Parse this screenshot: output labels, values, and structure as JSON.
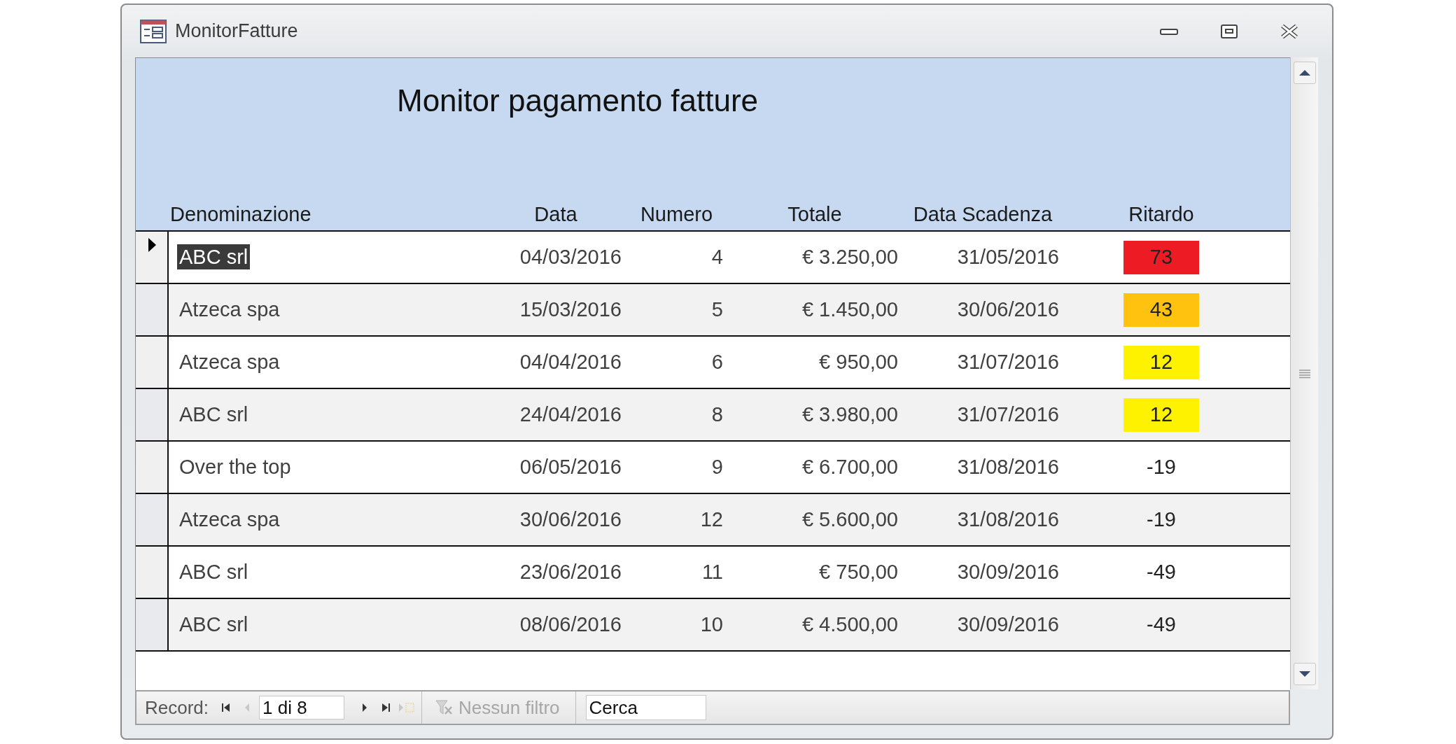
{
  "window": {
    "title": "MonitorFatture"
  },
  "form": {
    "heading": "Monitor pagamento fatture",
    "columns": [
      "Denominazione",
      "Data",
      "Numero",
      "Totale",
      "Data Scadenza",
      "Ritardo"
    ],
    "rows": [
      {
        "selected": true,
        "highlighted": true,
        "name": "ABC srl",
        "data": "04/03/2016",
        "numero": "4",
        "totale": "€ 3.250,00",
        "scadenza": "31/05/2016",
        "ritardo": "73",
        "color": "#ed1c24"
      },
      {
        "selected": false,
        "highlighted": false,
        "name": "Atzeca spa",
        "data": "15/03/2016",
        "numero": "5",
        "totale": "€ 1.450,00",
        "scadenza": "30/06/2016",
        "ritardo": "43",
        "color": "#ffc20e"
      },
      {
        "selected": false,
        "highlighted": false,
        "name": "Atzeca spa",
        "data": "04/04/2016",
        "numero": "6",
        "totale": "€ 950,00",
        "scadenza": "31/07/2016",
        "ritardo": "12",
        "color": "#fff200"
      },
      {
        "selected": false,
        "highlighted": false,
        "name": "ABC srl",
        "data": "24/04/2016",
        "numero": "8",
        "totale": "€ 3.980,00",
        "scadenza": "31/07/2016",
        "ritardo": "12",
        "color": "#fff200"
      },
      {
        "selected": false,
        "highlighted": false,
        "name": "Over the top",
        "data": "06/05/2016",
        "numero": "9",
        "totale": "€ 6.700,00",
        "scadenza": "31/08/2016",
        "ritardo": "-19"
      },
      {
        "selected": false,
        "highlighted": false,
        "name": "Atzeca spa",
        "data": "30/06/2016",
        "numero": "12",
        "totale": "€ 5.600,00",
        "scadenza": "31/08/2016",
        "ritardo": "-19"
      },
      {
        "selected": false,
        "highlighted": false,
        "name": "ABC srl",
        "data": "23/06/2016",
        "numero": "11",
        "totale": "€ 750,00",
        "scadenza": "30/09/2016",
        "ritardo": "-49"
      },
      {
        "selected": false,
        "highlighted": false,
        "name": "ABC srl",
        "data": "08/06/2016",
        "numero": "10",
        "totale": "€ 4.500,00",
        "scadenza": "30/09/2016",
        "ritardo": "-49"
      }
    ]
  },
  "navigation": {
    "label": "Record:",
    "position": "1 di 8",
    "buttons": [
      {
        "kind": "first",
        "disabled": false
      },
      {
        "kind": "prev",
        "disabled": true
      },
      {
        "kind": "next",
        "disabled": false
      },
      {
        "kind": "last",
        "disabled": false
      },
      {
        "kind": "new",
        "disabled": true
      }
    ],
    "filter": {
      "label": "Nessun filtro",
      "disabled": true
    },
    "search": {
      "value": "Cerca"
    }
  }
}
